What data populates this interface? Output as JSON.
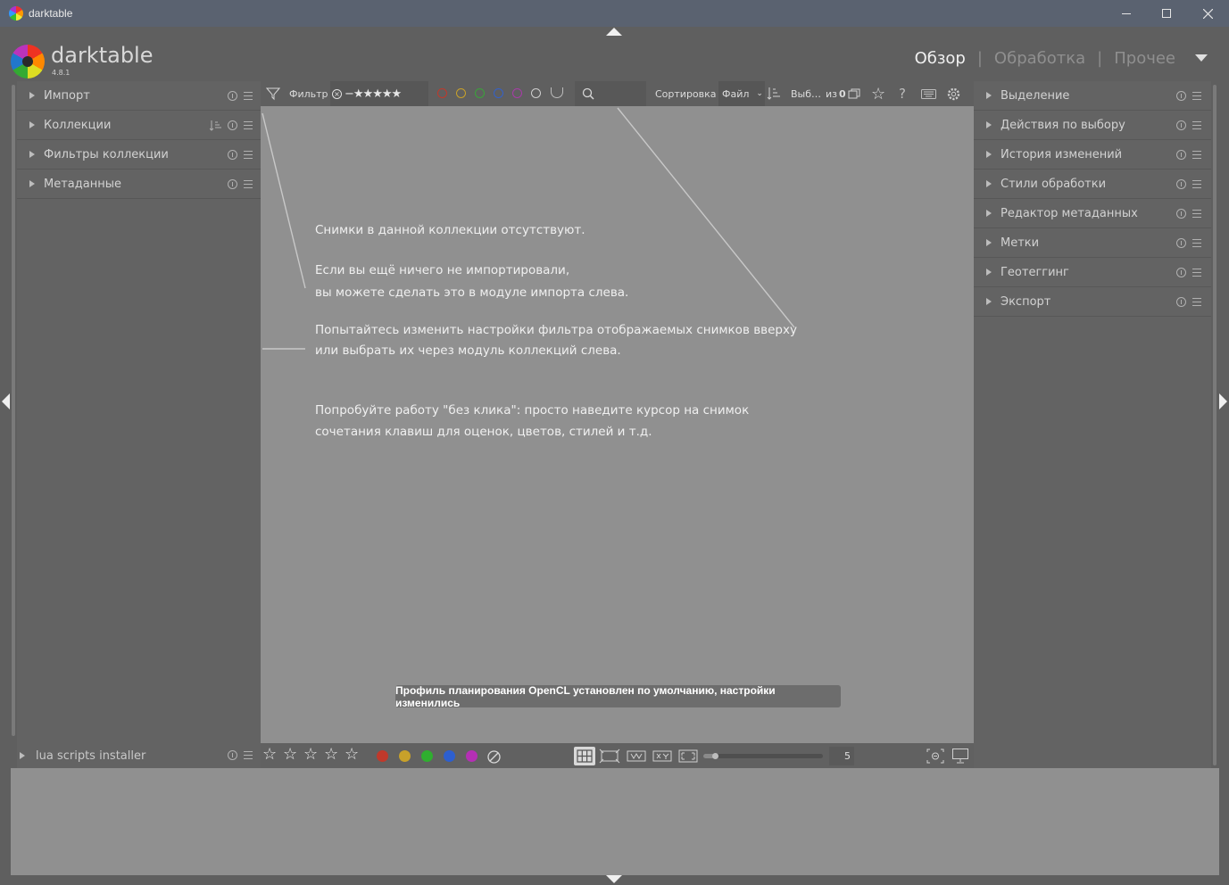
{
  "window": {
    "title": "darktable",
    "controls": [
      "minimize",
      "maximize",
      "close"
    ]
  },
  "header": {
    "brand": "darktable",
    "version": "4.8.1",
    "views": [
      {
        "label": "Обзор",
        "active": true
      },
      {
        "label": "Обработка",
        "active": false
      },
      {
        "label": "Прочее",
        "active": false
      }
    ]
  },
  "left_panel": {
    "modules": [
      {
        "label": "Импорт"
      },
      {
        "label": "Коллекции"
      },
      {
        "label": "Фильтры коллекции"
      },
      {
        "label": "Метаданные"
      }
    ],
    "lua_label": "lua scripts installer"
  },
  "right_panel": {
    "modules": [
      {
        "label": "Выделение"
      },
      {
        "label": "Действия по выбору"
      },
      {
        "label": "История изменений"
      },
      {
        "label": "Стили обработки"
      },
      {
        "label": "Редактор метаданных"
      },
      {
        "label": "Метки"
      },
      {
        "label": "Геотеггинг"
      },
      {
        "label": "Экспорт"
      }
    ]
  },
  "toolbar": {
    "filter_label": "Фильтр",
    "sort_label": "Сортировка",
    "sort_value": "Файл",
    "selected_label": "Выб…",
    "count_label": "из",
    "count_value": "0",
    "color_labels": [
      "#c0392b",
      "#c8a12a",
      "#3aa33a",
      "#3461c9",
      "#a83ba8",
      "#cfcfcf"
    ]
  },
  "center": {
    "empty_title": "Снимки в данной коллекции отсутствуют.",
    "hint_import_1": "Если вы ещё ничего не импортировали,",
    "hint_import_2": "вы можете сделать это в модуле импорта слева.",
    "hint_filter_1": "Попытайтесь изменить настройки фильтра отображаемых снимков вверху",
    "hint_filter_2": "или выбрать их через модуль коллекций слева.",
    "hint_hover_1": "Попробуйте работу \"без клика\": просто наведите курсор на снимок",
    "hint_hover_2": "сочетания клавиш для оценок, цветов, стилей и т.д.",
    "toast": "Профиль планирования OpenCL установлен по умолчанию, настройки изменились"
  },
  "bottombar": {
    "stars": 5,
    "colors": [
      "#c0392b",
      "#c8a12a",
      "#2fae2f",
      "#2d5fcf",
      "#b52fb5"
    ],
    "zoom_value": "5",
    "zoom_level": 0.1
  }
}
